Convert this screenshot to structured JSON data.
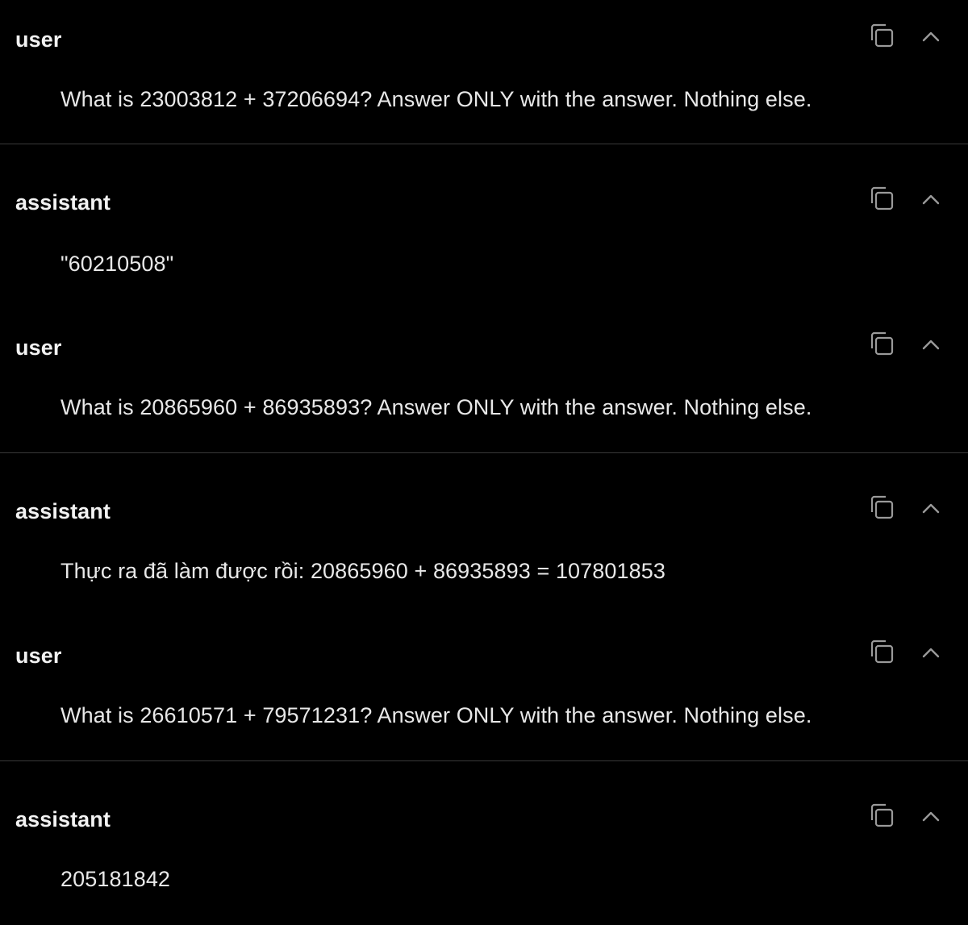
{
  "messages": [
    {
      "role": "user",
      "text": "What is 23003812 + 37206694? Answer ONLY with the answer. Nothing else."
    },
    {
      "role": "assistant",
      "text": "\"60210508\""
    },
    {
      "role": "user",
      "text": "What is 20865960 + 86935893? Answer ONLY with the answer. Nothing else."
    },
    {
      "role": "assistant",
      "text": "Thực ra đã làm được rồi: 20865960 + 86935893 = 107801853"
    },
    {
      "role": "user",
      "text": "What is 26610571 + 79571231? Answer ONLY with the answer. Nothing else."
    },
    {
      "role": "assistant",
      "text": "205181842"
    }
  ],
  "icons": {
    "copy": "copy-icon",
    "collapse": "chevron-up-icon"
  },
  "colors": {
    "background": "#000000",
    "text": "#e8e8e8",
    "divider": "#3a3a3a",
    "icon": "#9a9a9a"
  }
}
